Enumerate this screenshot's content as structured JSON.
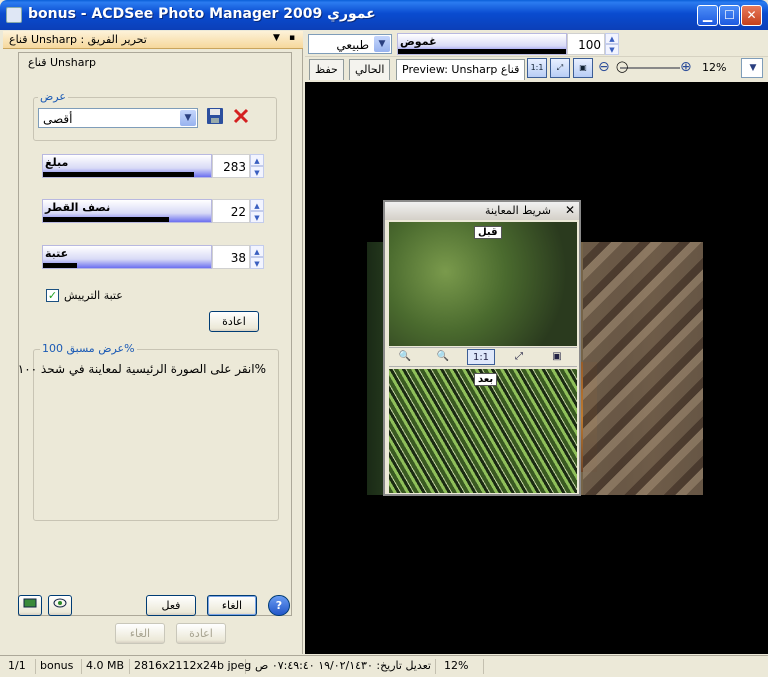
{
  "window": {
    "title": "bonus - ACDSee Photo Manager 2009 عموري",
    "min_glyph": "▁",
    "max_glyph": "☐",
    "close_glyph": "✕"
  },
  "panel": {
    "header": "قناع Unsharp : تحرير الفريق",
    "dropdown_glyph": "▼",
    "pin_glyph": "▪",
    "tool_name": "قناع Unsharp",
    "view_label": "عرض",
    "preset_value": "أقصى",
    "amount_label": "مبلغ",
    "amount_value": "283",
    "amount_level": 0.9,
    "radius_label": "نصف القطر",
    "radius_value": "22",
    "radius_level": 0.75,
    "threshold_label": "عتبة",
    "threshold_value": "38",
    "threshold_level": 0.2,
    "checkbox_label": "عتبة الترييش",
    "reset_label": "اعادة",
    "preview_label": "عرض مسبق 100%",
    "preview_text": "%انقر على الصورة الرئيسية لمعاينة في شحذ ١٠٠",
    "apply_label": "فعل",
    "cancel_label": "الغاء",
    "undo_label": "الغاء",
    "redo_label": "اعادة"
  },
  "toolbar": {
    "mode_value": "طبيعي",
    "amount_label": "غموض",
    "amount_value": "100",
    "amount_level": 1.0,
    "tab_save": "حفظ",
    "tab_current": "الحالي",
    "tab_preview": "Preview: Unsharp قناع",
    "zoom_value": "12%"
  },
  "popup": {
    "title": "شريط المعاينة",
    "before_label": "قبل",
    "after_label": "بعد",
    "close_glyph": "✕"
  },
  "status": {
    "index": "1/1",
    "name": "bonus",
    "size": "4.0 MB",
    "dims": "2816x2112x24b jpeg",
    "modified": "تعديل تاريخ: ١٩/٠٢/١٤٣٠ ٠٧:٤٩:٤٠ ص",
    "zoom": "12%"
  }
}
